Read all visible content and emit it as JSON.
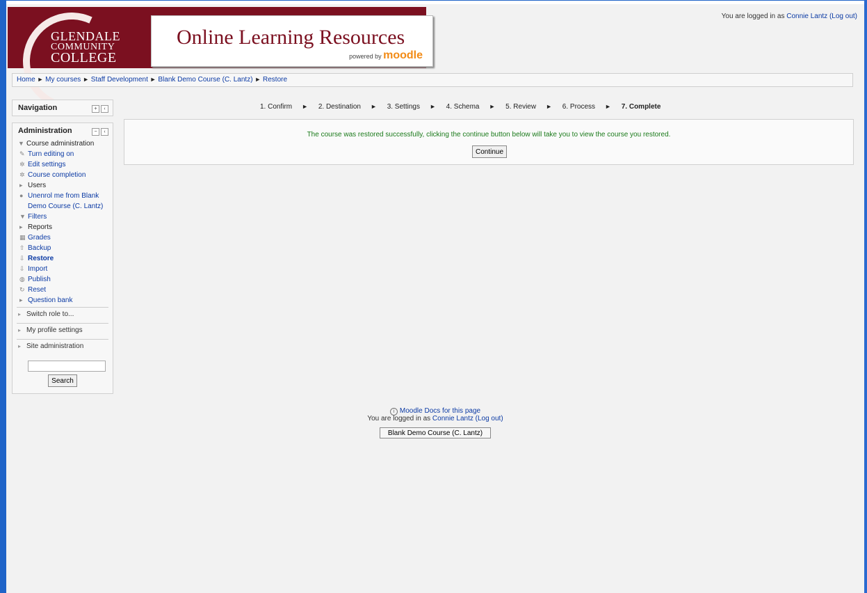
{
  "header": {
    "college_line1": "GLENDALE",
    "college_line2": "COMMUNITY",
    "college_line3": "COLLEGE",
    "site_title": "Online Learning Resources",
    "powered_by": "powered by",
    "moodle": "moodle",
    "login_text": "You are logged in as",
    "login_user": "Connie Lantz",
    "logout": "(Log out)"
  },
  "breadcrumb": [
    "Home",
    "My courses",
    "Staff Development",
    "Blank Demo Course (C. Lantz)",
    "Restore"
  ],
  "navigation": {
    "title": "Navigation"
  },
  "administration": {
    "title": "Administration",
    "course_admin": "Course administration",
    "items": [
      {
        "label": "Turn editing on",
        "icon": "pencil-icon"
      },
      {
        "label": "Edit settings",
        "icon": "gear-icon"
      },
      {
        "label": "Course completion",
        "icon": "gear-icon"
      },
      {
        "label": "Users",
        "icon": "triangle-right-icon"
      },
      {
        "label": "Unenrol me from Blank Demo Course (C. Lantz)",
        "icon": "user-icon"
      },
      {
        "label": "Filters",
        "icon": "filter-icon"
      },
      {
        "label": "Reports",
        "icon": "triangle-right-icon"
      },
      {
        "label": "Grades",
        "icon": "grades-icon"
      },
      {
        "label": "Backup",
        "icon": "backup-icon"
      },
      {
        "label": "Restore",
        "icon": "restore-icon"
      },
      {
        "label": "Import",
        "icon": "import-icon"
      },
      {
        "label": "Publish",
        "icon": "globe-icon"
      },
      {
        "label": "Reset",
        "icon": "reset-icon"
      },
      {
        "label": "Question bank",
        "icon": "triangle-right-icon"
      }
    ],
    "switch_role": "Switch role to...",
    "profile": "My profile settings",
    "site_admin": "Site administration",
    "search_button": "Search"
  },
  "steps": [
    "1. Confirm",
    "2. Destination",
    "3. Settings",
    "4. Schema",
    "5. Review",
    "6. Process",
    "7. Complete"
  ],
  "result": {
    "message": "The course was restored successfully, clicking the continue button below will take you to view the course you restored.",
    "continue": "Continue"
  },
  "footer": {
    "docs": "Moodle Docs for this page",
    "login_text": "You are logged in as",
    "login_user": "Connie Lantz",
    "logout": "(Log out)",
    "course_button": "Blank Demo Course (C. Lantz)"
  }
}
